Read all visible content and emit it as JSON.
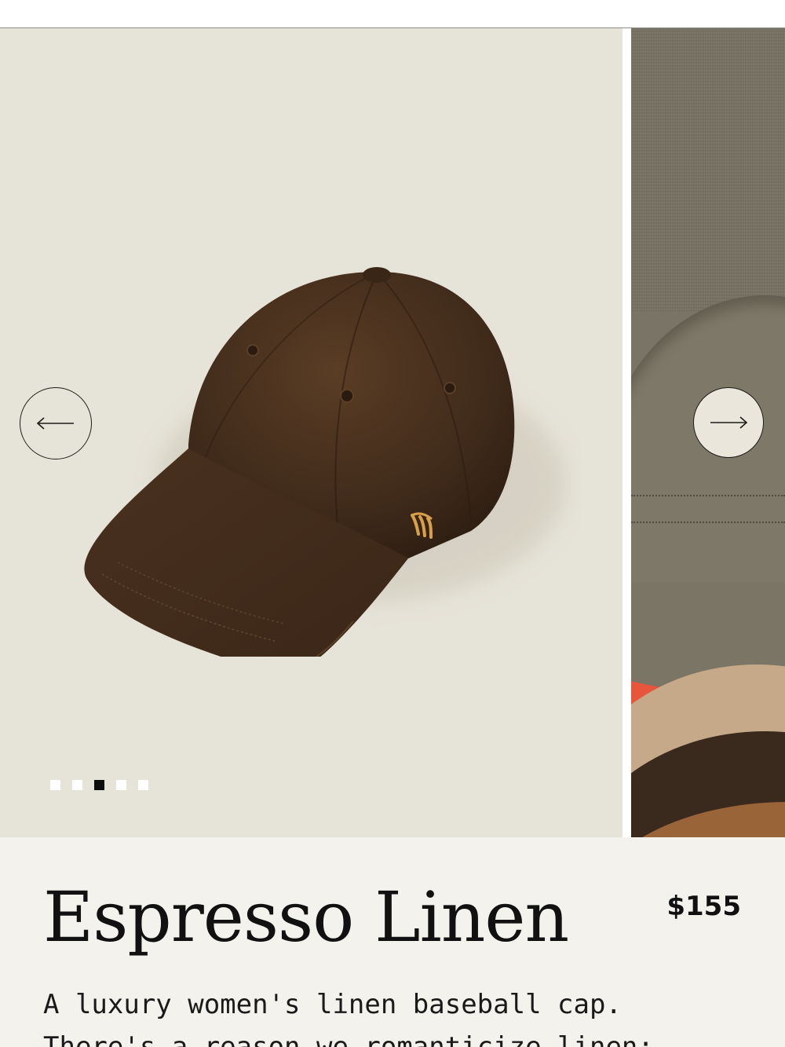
{
  "gallery": {
    "prev_arrow_icon": "arrow-left-icon",
    "next_arrow_icon": "arrow-right-icon",
    "slide_count": 5,
    "active_slide": 3,
    "colors": {
      "background": "#e6e3d8",
      "cap": "#4a3220",
      "logo": "#d9a04a"
    }
  },
  "product": {
    "title": "Espresso Linen",
    "price": "$155",
    "description_line1": "A luxury women's linen baseball cap.",
    "description_line2": "There's a reason we romanticize linen:"
  }
}
